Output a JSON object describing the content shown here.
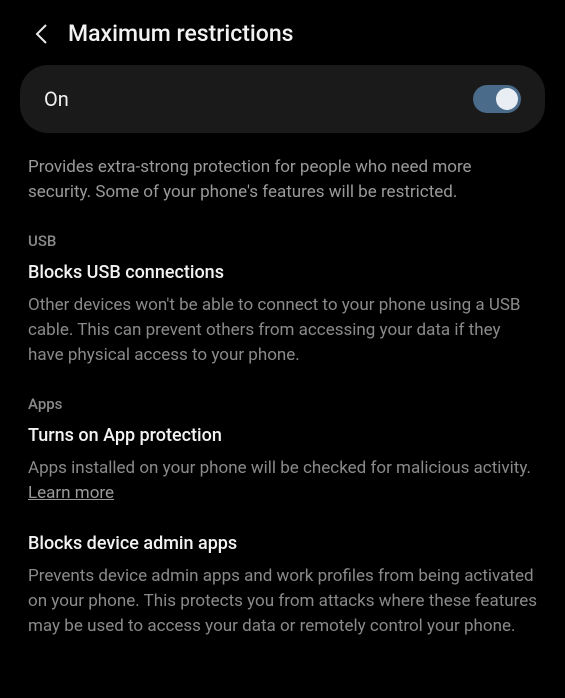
{
  "header": {
    "title": "Maximum restrictions"
  },
  "toggle": {
    "label": "On",
    "state": true
  },
  "intro": {
    "text": "Provides extra-strong protection for people who need more security. Some of your phone's features will be restricted."
  },
  "sections": {
    "usb": {
      "label": "USB",
      "items": [
        {
          "title": "Blocks USB connections",
          "desc": "Other devices won't be able to connect to your phone using a USB cable. This can prevent others from accessing your data if they have physical access to your phone."
        }
      ]
    },
    "apps": {
      "label": "Apps",
      "items": [
        {
          "title": "Turns on App protection",
          "desc": "Apps installed on your phone will be checked for malicious activity. ",
          "link": "Learn more"
        },
        {
          "title": "Blocks device admin apps",
          "desc": "Prevents device admin apps and work profiles from being activated on your phone. This protects you from attacks where these features may be used to access your data or remotely control your phone."
        }
      ]
    }
  }
}
